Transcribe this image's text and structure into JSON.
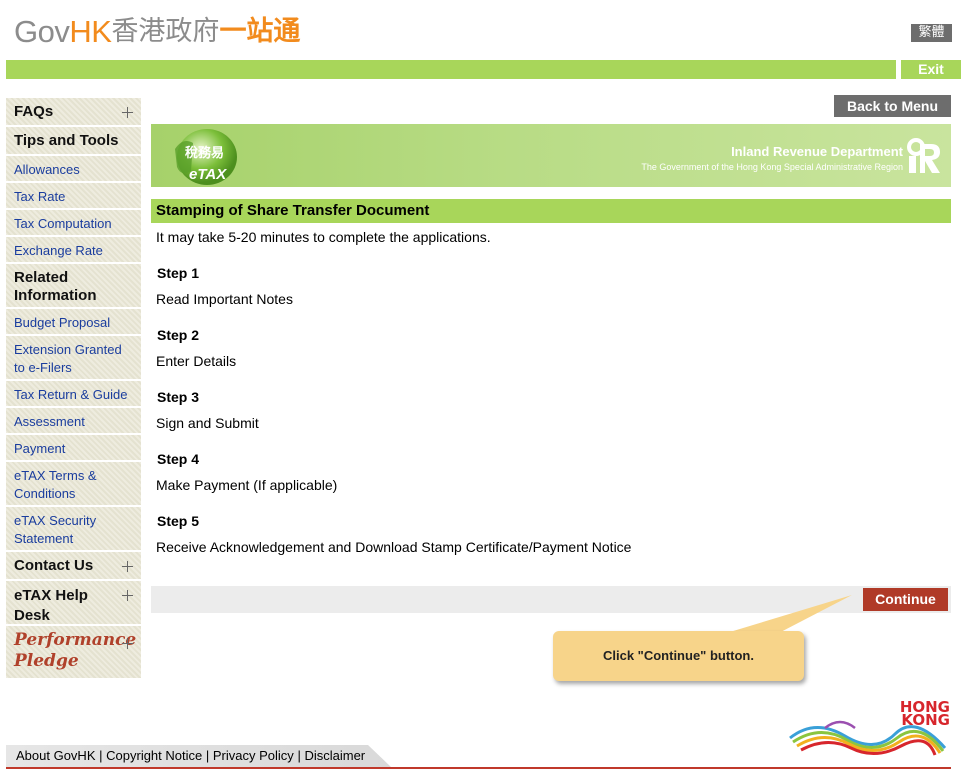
{
  "header": {
    "logo_gov": "Gov",
    "logo_hk": "HK",
    "logo_cn_gray": "香港政府",
    "logo_cn_orange": "一站通",
    "lang_label": "繁體",
    "exit_label": "Exit"
  },
  "sidebar": {
    "faqs": "FAQs",
    "tips_heading": "Tips and Tools",
    "tips_links": [
      "Allowances",
      "Tax Rate",
      "Tax Computation",
      "Exchange Rate"
    ],
    "related_heading": "Related Information",
    "related_links": [
      "Budget Proposal",
      "Extension Granted to e-Filers",
      "Tax Return & Guide",
      "Assessment",
      "Payment",
      "eTAX Terms & Conditions",
      "eTAX Security Statement"
    ],
    "contact": "Contact Us",
    "help_desk": "eTAX Help Desk",
    "pledge_line1": "Performance",
    "pledge_line2": "Pledge"
  },
  "main": {
    "back_label": "Back to Menu",
    "banner": {
      "etax_cn": "稅務易",
      "etax_en": "eTAX",
      "dept_name": "Inland Revenue Department",
      "gov_name": "The Government of the Hong Kong Special Administrative Region"
    },
    "title": "Stamping of Share Transfer Document",
    "intro": "It may take 5-20 minutes to complete the applications.",
    "steps": [
      {
        "label": "Step 1",
        "text": "Read Important Notes"
      },
      {
        "label": "Step 2",
        "text": "Enter Details"
      },
      {
        "label": "Step 3",
        "text": "Sign and Submit"
      },
      {
        "label": "Step 4",
        "text": "Make Payment (If applicable)"
      },
      {
        "label": "Step 5",
        "text": "Receive Acknowledgement and Download Stamp Certificate/Payment Notice"
      }
    ],
    "continue_label": "Continue",
    "callout": "Click \"Continue\" button."
  },
  "footer": {
    "links": [
      "About GovHK",
      "Copyright Notice",
      "Privacy Policy",
      "Disclaimer"
    ],
    "separator": "|",
    "brand_line1": "HONG",
    "brand_line2": "KONG"
  },
  "colors": {
    "accent_green": "#a8d65a",
    "continue_red": "#b03a27",
    "link_blue": "#1a3d9e",
    "callout_yellow": "#f7d48a"
  }
}
